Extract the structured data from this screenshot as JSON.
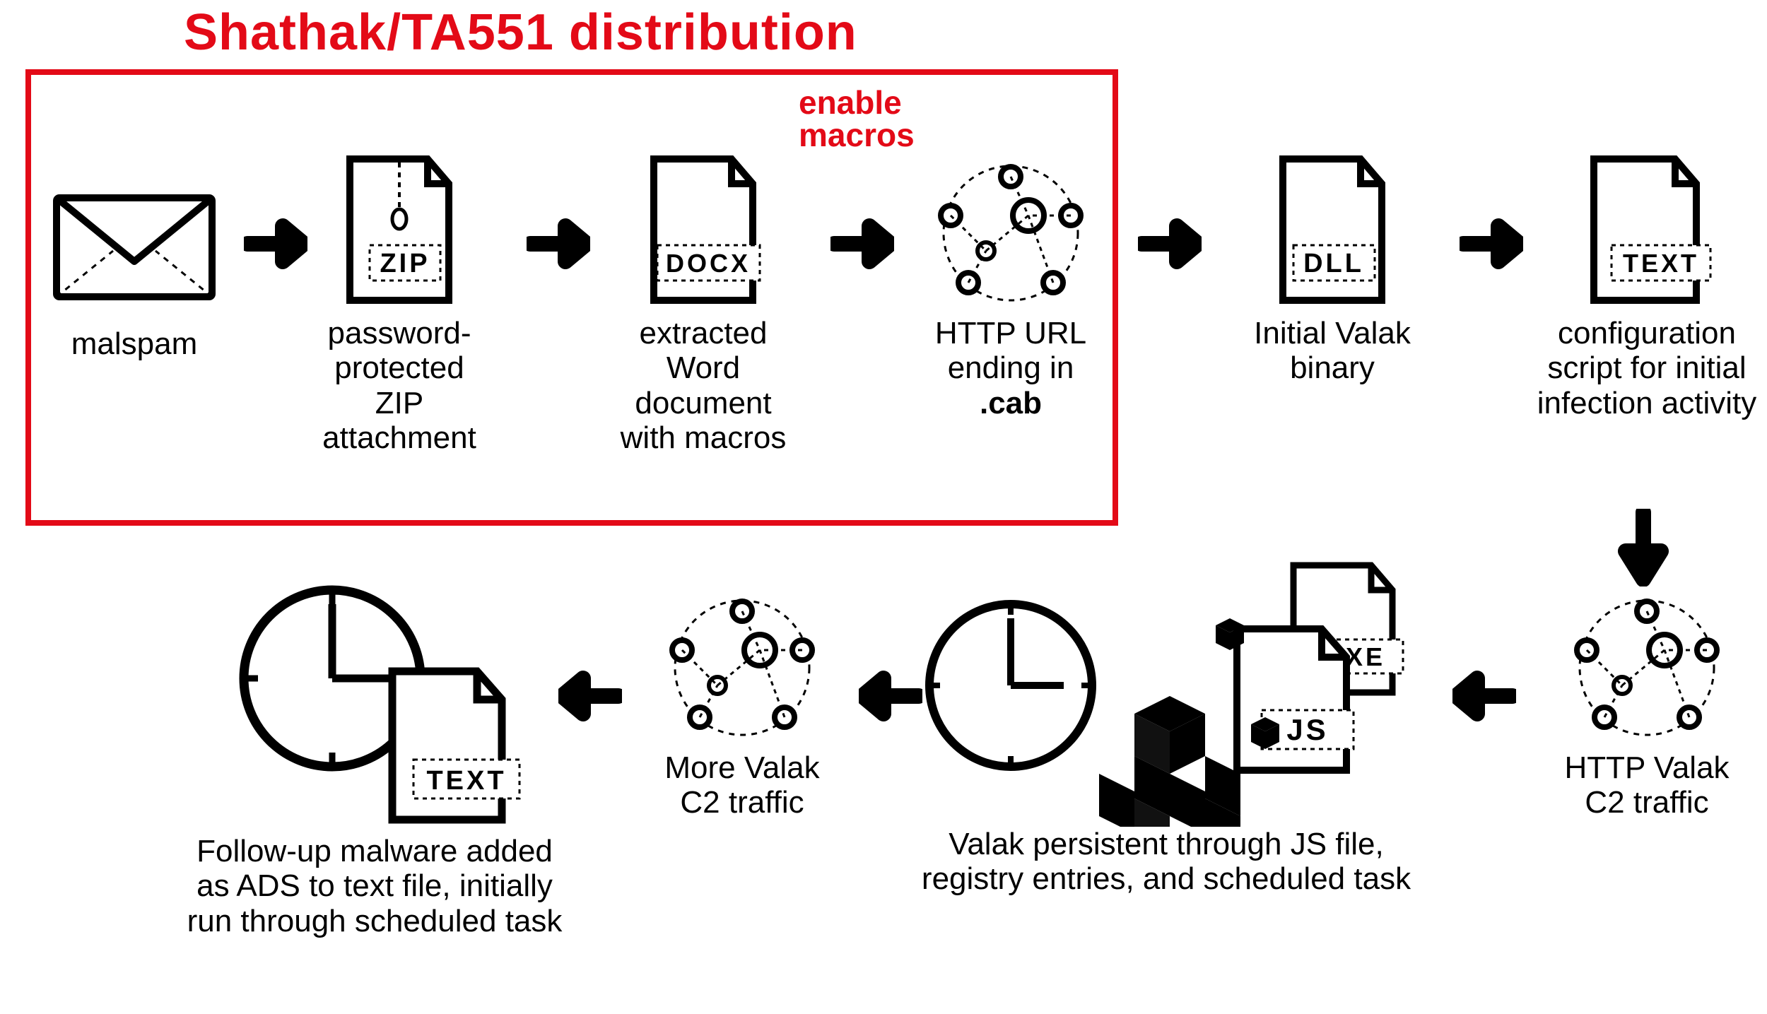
{
  "title": "Shathak/TA551 distribution",
  "enable_macros_line1": "enable",
  "enable_macros_line2": "macros",
  "nodes": {
    "malspam": {
      "label": "malspam"
    },
    "zip": {
      "label": "password-\nprotected ZIP\nattachment",
      "tag": "ZIP"
    },
    "docx": {
      "label": "extracted\nWord\ndocument\nwith macros",
      "tag": "DOCX"
    },
    "cab": {
      "label_pre": "HTTP URL\nending in",
      "label_bold": ".cab"
    },
    "dll": {
      "label": "Initial Valak\nbinary",
      "tag": "DLL"
    },
    "text1": {
      "label": "configuration\nscript for initial\ninfection activity",
      "tag": "TEXT"
    },
    "c2_1": {
      "label": "HTTP Valak\nC2 traffic"
    },
    "persist": {
      "label": "Valak persistent through JS file,\nregistry entries, and scheduled task",
      "tag1": "EXE",
      "tag2": "JS"
    },
    "c2_2": {
      "label": "More Valak\nC2 traffic"
    },
    "followup": {
      "label": "Follow-up malware added\nas ADS to text file, initially\nrun through scheduled task",
      "tag": "TEXT"
    }
  }
}
